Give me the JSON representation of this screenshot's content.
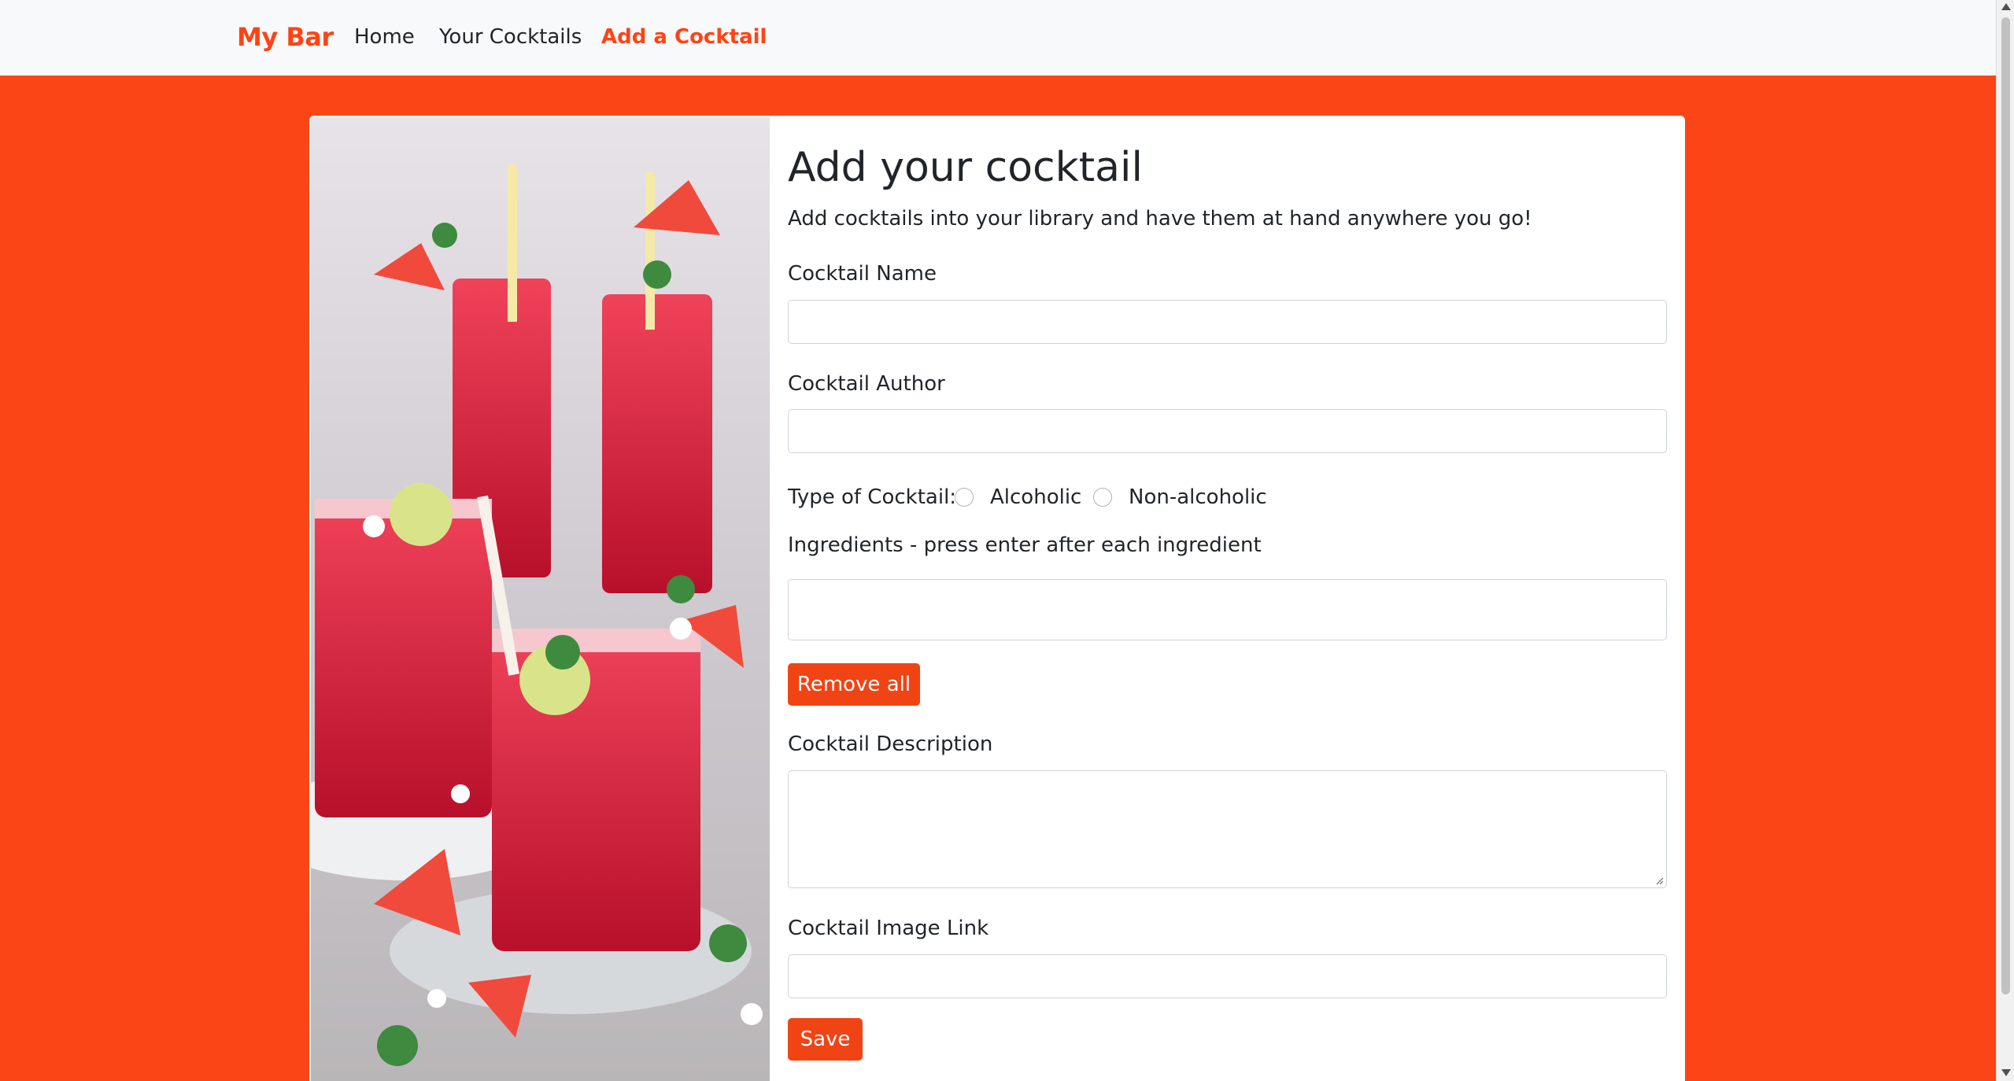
{
  "navbar": {
    "brand": "My Bar",
    "links": [
      "Home",
      "Your Cocktails",
      "Add a Cocktail"
    ],
    "active": "Add a Cocktail"
  },
  "form": {
    "title": "Add your cocktail",
    "subtitle": "Add cocktails into your library and have them at hand anywhere you go!",
    "name_label": "Cocktail Name",
    "name_value": "",
    "author_label": "Cocktail Author",
    "author_value": "",
    "type_label": "Type of Cocktail:",
    "type_options": [
      "Alcoholic",
      "Non-alcoholic"
    ],
    "ingredients_label": "Ingredients - press enter after each ingredient",
    "ingredients_value": "",
    "remove_all_label": "Remove all",
    "description_label": "Cocktail Description",
    "description_value": "",
    "image_label": "Cocktail Image Link",
    "image_value": "",
    "save_label": "Save"
  },
  "colors": {
    "accent": "#fc4517",
    "button": "#f04415",
    "navbar_bg": "#f8f9fa"
  }
}
